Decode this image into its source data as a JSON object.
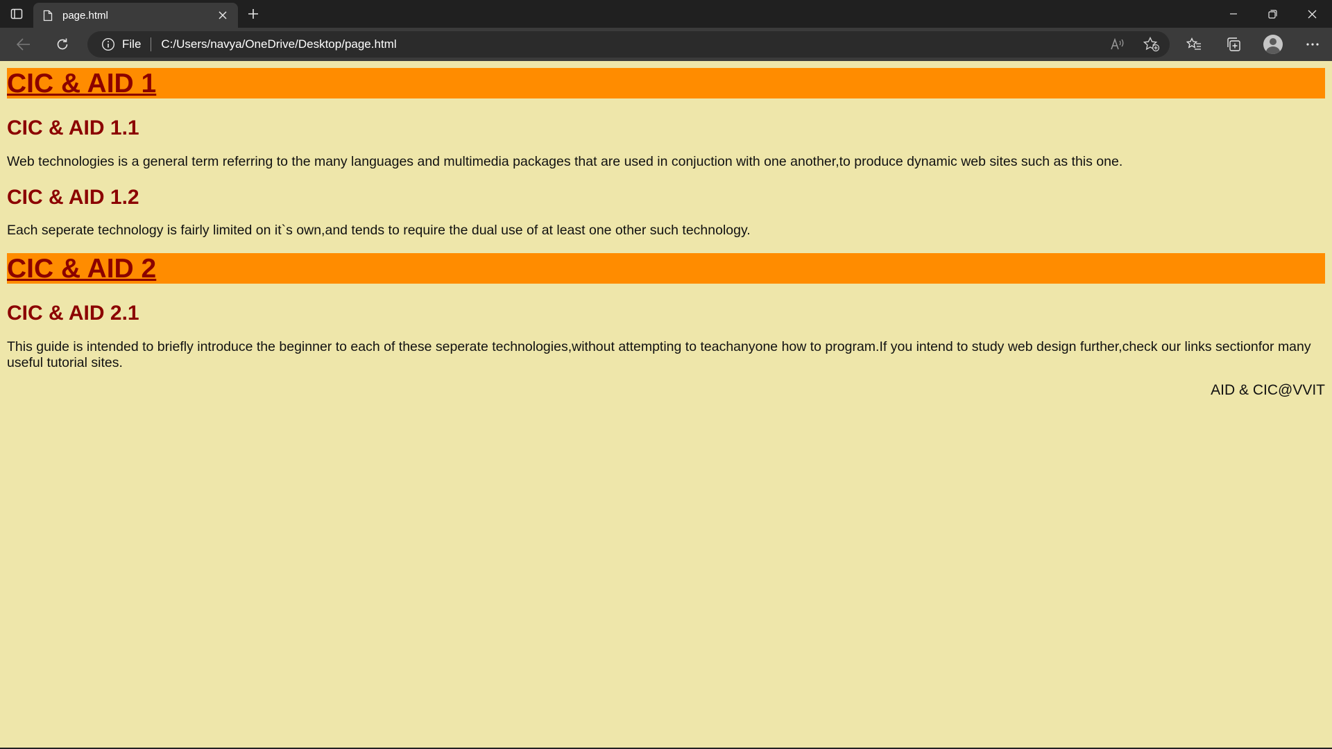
{
  "browser": {
    "tab_title": "page.html",
    "address_scheme_label": "File",
    "url": "C:/Users/navya/OneDrive/Desktop/page.html"
  },
  "colors": {
    "page_background": "#eee6aa",
    "band_background": "#ff8c00",
    "heading_color": "#8b0000"
  },
  "content": {
    "section1": {
      "title": "CIC & AID 1",
      "sub1_title": "CIC & AID 1.1",
      "sub1_text": "Web technologies is a general term referring to the many languages and multimedia packages that are used in conjuction with one another,to produce dynamic web sites such as this one.",
      "sub2_title": "CIC & AID 1.2",
      "sub2_text": "Each seperate technology is fairly limited on it`s own,and tends to require the dual use of at least one other such technology."
    },
    "section2": {
      "title": "CIC & AID 2",
      "sub1_title": "CIC & AID 2.1",
      "sub1_text": "This guide is intended to briefly introduce the beginner to each of these seperate technologies,without attempting to teachanyone how to program.If you intend to study web design further,check our links sectionfor many useful tutorial sites."
    },
    "footer": "AID & CIC@VVIT"
  }
}
